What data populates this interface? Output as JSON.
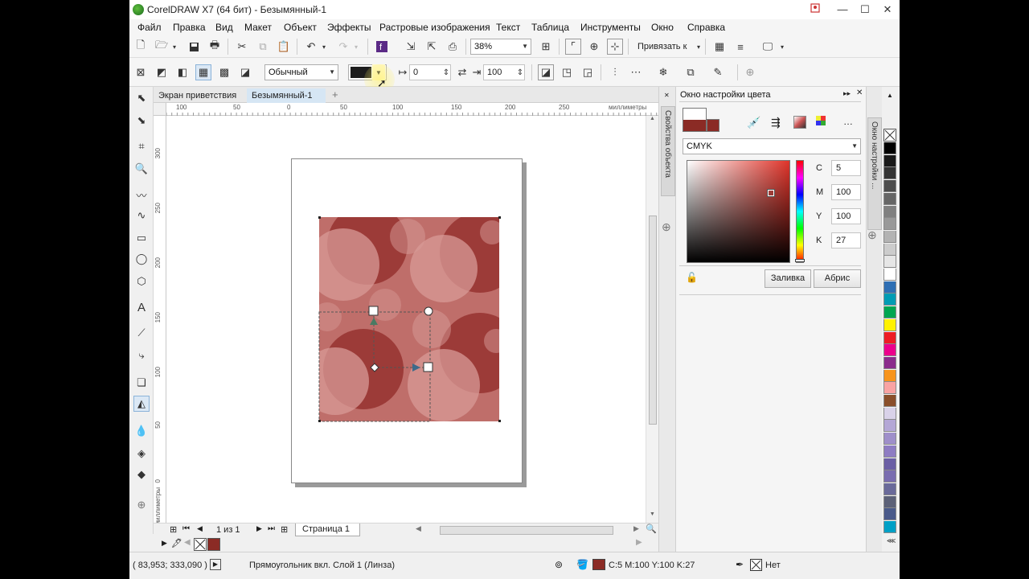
{
  "window": {
    "title": "CorelDRAW X7 (64 бит) - Безымянный-1"
  },
  "menu": [
    {
      "label": "Файл"
    },
    {
      "label": "Правка"
    },
    {
      "label": "Вид"
    },
    {
      "label": "Макет"
    },
    {
      "label": "Объект"
    },
    {
      "label": "Эффекты"
    },
    {
      "label": "Растровые изображения"
    },
    {
      "label": "Текст"
    },
    {
      "label": "Таблица"
    },
    {
      "label": "Инструменты"
    },
    {
      "label": "Окно"
    },
    {
      "label": "Справка"
    }
  ],
  "standard_toolbar": {
    "zoom_value": "38%",
    "snap_label": "Привязать к"
  },
  "property_bar": {
    "blend_mode": "Обычный",
    "offset_x": "0",
    "size_value": "100"
  },
  "doc_tabs": [
    {
      "label": "Экран приветствия"
    },
    {
      "label": "Безымянный-1"
    }
  ],
  "rulers": {
    "unit": "миллиметры",
    "h_ticks": [
      "100",
      "50",
      "0",
      "50",
      "100",
      "150",
      "200",
      "250"
    ],
    "v_ticks": [
      "300",
      "250",
      "200",
      "150",
      "100",
      "50",
      "0"
    ]
  },
  "page_nav": {
    "page_count": "1 из 1",
    "page_tab": "Страница 1"
  },
  "status": {
    "coordinates": "( 83,953; 333,090 )",
    "object_info": "Прямоугольник вкл. Слой 1  (Линза)",
    "fill_info": "C:5 M:100 Y:100 K:27",
    "outline_info": "Нет"
  },
  "dock_tab_label": "Свойства объекта",
  "color_panel": {
    "title": "Окно настройки цвета",
    "model": "CMYK",
    "c": "5",
    "m": "100",
    "y": "100",
    "k": "27",
    "fill_button": "Заливка",
    "outline_button": "Абрис",
    "color_hex": "#8b2b25"
  },
  "right_tab_label": "Окно настройки ...",
  "palette_colors": [
    "#000000",
    "#1a1a1a",
    "#333333",
    "#4d4d4d",
    "#666666",
    "#808080",
    "#999999",
    "#b3b3b3",
    "#cccccc",
    "#e6e6e6",
    "#ffffff",
    "#2f6fb4",
    "#009cb4",
    "#00a651",
    "#fff200",
    "#ed1c24",
    "#ec008c",
    "#8b2b8c",
    "#f7941d",
    "#f9a3a3",
    "#8a4f2b",
    "#d9d2e9",
    "#b4a7d6",
    "#9f8fca",
    "#8e7cc3",
    "#6b5fa5",
    "#7a6db0",
    "#6a6a9a",
    "#5c6178",
    "#4a5a8a",
    "#00a0c6"
  ]
}
